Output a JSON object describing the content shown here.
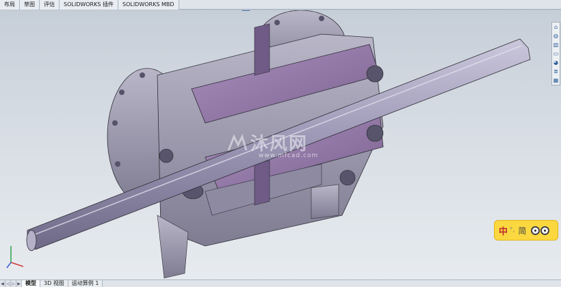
{
  "command_tabs": [
    {
      "label": "布局",
      "active": false
    },
    {
      "label": "草图",
      "active": false
    },
    {
      "label": "评估",
      "active": false
    },
    {
      "label": "SOLIDWORKS 插件",
      "active": false
    },
    {
      "label": "SOLIDWORKS MBD",
      "active": false
    }
  ],
  "heads_up_toolbar": [
    "zoom-to-fit-icon",
    "zoom-area-icon",
    "previous-view-icon",
    "section-view-icon",
    "view-orientation-icon",
    "display-style-icon",
    "hide-show-icon",
    "edit-appearance-icon",
    "apply-scene-icon",
    "view-settings-icon"
  ],
  "window_controls": [
    "restore-icon",
    "tile-icon",
    "maximize-icon",
    "close-icon"
  ],
  "task_pane": [
    "home-icon",
    "resources-icon",
    "design-library-icon",
    "file-explorer-icon",
    "appearances-icon",
    "custom-properties-icon",
    "view-palette-icon"
  ],
  "watermark": {
    "text": "沐风网",
    "url": "www.mfcad.com"
  },
  "ime": {
    "mode": "中",
    "punct": "°,",
    "script": "简"
  },
  "bottom_tabs": [
    {
      "label": "模型",
      "active": true
    },
    {
      "label": "3D 视图",
      "active": false
    },
    {
      "label": "运动算例 1",
      "active": false
    }
  ],
  "colors": {
    "model_surface": "#9e9bb0",
    "model_cut": "#8a6f9e",
    "viewport_top": "#c6ced8",
    "accent": "#3e6ea8",
    "ime_bg": "#fbd83f"
  }
}
